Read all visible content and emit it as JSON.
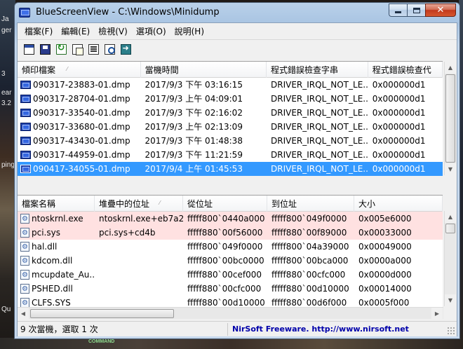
{
  "window": {
    "title": "BlueScreenView  -  C:\\Windows\\Minidump"
  },
  "desktop": {
    "side_labels": [
      "Ja",
      "ger",
      "3",
      "ear",
      "3.2",
      "ping",
      "Qu"
    ],
    "bottom_labels": [
      "COMMAND"
    ]
  },
  "menu": {
    "items": [
      "檔案(F)",
      "編輯(E)",
      "檢視(V)",
      "選項(O)",
      "說明(H)"
    ]
  },
  "toolbar": {
    "icons": [
      "properties-icon",
      "save-icon",
      "refresh-icon",
      "copy-icon",
      "html-report-icon",
      "find-icon",
      "exit-icon"
    ]
  },
  "dumps": {
    "columns": [
      "傾印檔案",
      "當機時間",
      "程式錯誤檢查字串",
      "程式錯誤檢查代"
    ],
    "rows": [
      {
        "file": "090317-23883-01.dmp",
        "time": "2017/9/3 下午 03:16:15",
        "bugstr": "DRIVER_IRQL_NOT_LE...",
        "code": "0x000000d1"
      },
      {
        "file": "090317-28704-01.dmp",
        "time": "2017/9/3 上午 04:09:01",
        "bugstr": "DRIVER_IRQL_NOT_LE...",
        "code": "0x000000d1"
      },
      {
        "file": "090317-33540-01.dmp",
        "time": "2017/9/3 下午 02:16:02",
        "bugstr": "DRIVER_IRQL_NOT_LE...",
        "code": "0x000000d1"
      },
      {
        "file": "090317-33680-01.dmp",
        "time": "2017/9/3 上午 02:13:09",
        "bugstr": "DRIVER_IRQL_NOT_LE...",
        "code": "0x000000d1"
      },
      {
        "file": "090317-43430-01.dmp",
        "time": "2017/9/3 下午 01:48:38",
        "bugstr": "DRIVER_IRQL_NOT_LE...",
        "code": "0x000000d1"
      },
      {
        "file": "090317-44959-01.dmp",
        "time": "2017/9/3 下午 11:21:59",
        "bugstr": "DRIVER_IRQL_NOT_LE...",
        "code": "0x000000d1"
      },
      {
        "file": "090417-34055-01.dmp",
        "time": "2017/9/4 上午 01:45:53",
        "bugstr": "DRIVER_IRQL_NOT_LE...",
        "code": "0x000000d1"
      }
    ],
    "selected_index": 6
  },
  "drivers": {
    "columns": [
      "檔案名稱",
      "堆疊中的位址",
      "從位址",
      "到位址",
      "大小"
    ],
    "rows": [
      {
        "name": "ntoskrnl.exe",
        "stack": "ntoskrnl.exe+eb7a2",
        "from": "fffff800`0440a000",
        "to": "fffff800`049f0000",
        "size": "0x005e6000",
        "highlight": true
      },
      {
        "name": "pci.sys",
        "stack": "pci.sys+cd4b",
        "from": "fffff880`00f56000",
        "to": "fffff880`00f89000",
        "size": "0x00033000",
        "highlight": true
      },
      {
        "name": "hal.dll",
        "stack": "",
        "from": "fffff800`049f0000",
        "to": "fffff800`04a39000",
        "size": "0x00049000",
        "highlight": false
      },
      {
        "name": "kdcom.dll",
        "stack": "",
        "from": "fffff800`00bc0000",
        "to": "fffff800`00bca000",
        "size": "0x0000a000",
        "highlight": false
      },
      {
        "name": "mcupdate_Au...",
        "stack": "",
        "from": "fffff880`00cef000",
        "to": "fffff880`00cfc000",
        "size": "0x0000d000",
        "highlight": false
      },
      {
        "name": "PSHED.dll",
        "stack": "",
        "from": "fffff880`00cfc000",
        "to": "fffff880`00d10000",
        "size": "0x00014000",
        "highlight": false
      },
      {
        "name": "CLFS.SYS",
        "stack": "",
        "from": "fffff880`00d10000",
        "to": "fffff880`00d6f000",
        "size": "0x0005f000",
        "highlight": false
      }
    ]
  },
  "status": {
    "summary": "9 次當機，選取 1 次",
    "credit": "NirSoft Freeware.  http://www.nirsoft.net"
  },
  "colors": {
    "selection": "#3399ff",
    "highlight_row": "#ffe1e1",
    "credit_text": "#0000aa"
  }
}
